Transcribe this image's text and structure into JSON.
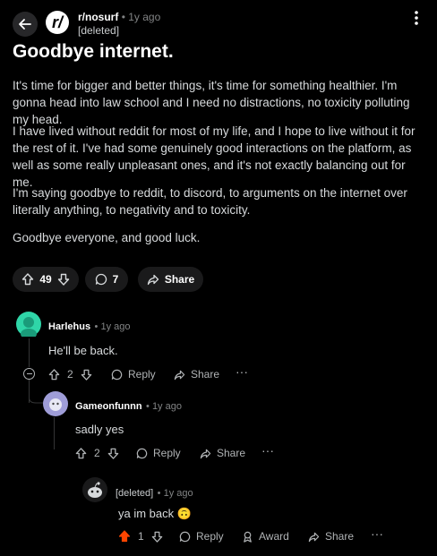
{
  "header": {
    "subreddit": "r/nosurf",
    "time": "1y ago",
    "author": "[deleted]",
    "sub_logo": "r/"
  },
  "post": {
    "title": "Goodbye internet.",
    "paragraphs": [
      "It's time for bigger and better things, it's time for something healthier. I'm gonna head into law school and I need no distractions, no toxicity polluting my head.",
      "I have lived without reddit for most of my life, and I hope to live without it for the rest of it. I've had some genuinely good interactions on the platform, as well as some really unpleasant ones, and it's not exactly balancing out for me.",
      "I'm saying goodbye to reddit, to discord, to arguments on the internet over literally anything, to negativity and to toxicity.",
      "Goodbye everyone, and good luck."
    ],
    "votes": "49",
    "comments": "7",
    "share_label": "Share"
  },
  "comments": [
    {
      "author": "Harlehus",
      "time": "1y ago",
      "text": "He'll be back.",
      "votes": "2",
      "reply": "Reply",
      "share": "Share"
    },
    {
      "author": "Gameonfunnn",
      "time": "1y ago",
      "text": "sadly yes",
      "votes": "2",
      "reply": "Reply",
      "share": "Share"
    },
    {
      "author": "[deleted]",
      "time": "1y ago",
      "text": "ya im back",
      "emoji": "🙃",
      "votes": "1",
      "reply": "Reply",
      "award": "Award",
      "share": "Share"
    }
  ],
  "colors": {
    "upvote_active": "#ff4500",
    "avatar_teal": "#2fd6a8",
    "avatar_purple": "#9f9dd8"
  },
  "icons": [
    "back-arrow-icon",
    "more-icon",
    "upvote-icon",
    "downvote-icon",
    "comment-icon",
    "share-icon",
    "collapse-icon",
    "award-icon"
  ]
}
